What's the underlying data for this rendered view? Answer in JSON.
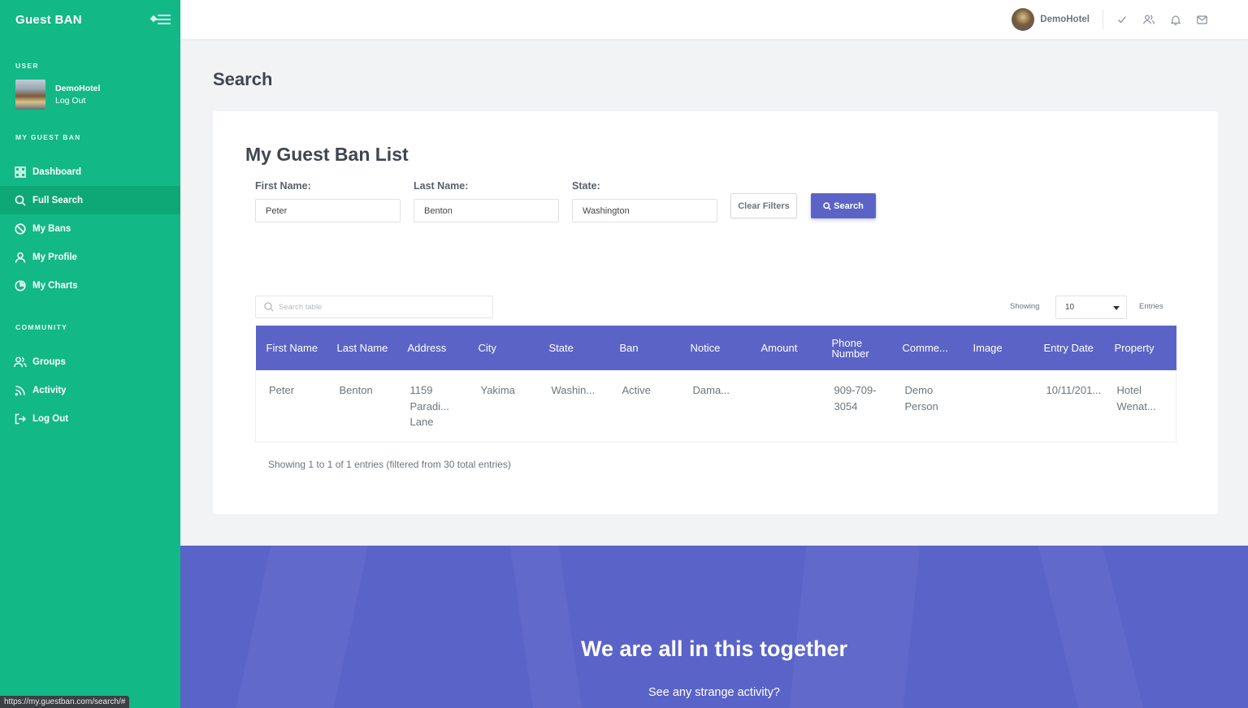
{
  "app": {
    "title": "Guest BAN"
  },
  "sidebar": {
    "user_section": "USER",
    "user_name": "DemoHotel",
    "logout_label": "Log Out",
    "main_section": "MY GUEST BAN",
    "main_items": [
      {
        "label": "Dashboard",
        "icon": "grid-icon",
        "active": false
      },
      {
        "label": "Full Search",
        "icon": "search-icon",
        "active": true
      },
      {
        "label": "My Bans",
        "icon": "ban-icon",
        "active": false
      },
      {
        "label": "My Profile",
        "icon": "user-icon",
        "active": false
      },
      {
        "label": "My Charts",
        "icon": "pie-chart-icon",
        "active": false
      }
    ],
    "community_section": "COMMUNITY",
    "community_items": [
      {
        "label": "Groups",
        "icon": "users-icon"
      },
      {
        "label": "Activity",
        "icon": "rss-icon"
      },
      {
        "label": "Log Out",
        "icon": "logout-icon"
      }
    ]
  },
  "header": {
    "user_name": "DemoHotel",
    "icons": [
      "check-icon",
      "users-icon",
      "bell-icon",
      "mail-icon"
    ]
  },
  "page": {
    "title": "Search"
  },
  "card": {
    "title": "My Guest Ban List",
    "filters": {
      "first_name_label": "First Name:",
      "first_name_value": "Peter",
      "last_name_label": "Last Name:",
      "last_name_value": "Benton",
      "state_label": "State:",
      "state_value": "Washington"
    },
    "clear_button": "Clear Filters",
    "search_button": "Search"
  },
  "table": {
    "search_placeholder": "Search table",
    "showing_label": "Showing",
    "page_size": "10",
    "entries_label": "Entries",
    "columns": [
      "First Name",
      "Last Name",
      "Address",
      "City",
      "State",
      "Ban",
      "Notice",
      "Amount",
      "Phone Number",
      "Comme...",
      "Image",
      "Entry Date",
      "Property"
    ],
    "rows": [
      [
        "Peter",
        "Benton",
        "1159 Paradi... Lane",
        "Yakima",
        "Washin...",
        "Active",
        "Dama...",
        "",
        "909-709-3054",
        "Demo Person",
        "",
        "10/11/201...",
        "Hotel Wenat..."
      ]
    ],
    "info": "Showing 1 to 1 of 1 entries (filtered from 30 total entries)"
  },
  "banner": {
    "title": "We are all in this together",
    "subtitle": "See any strange activity?"
  },
  "status_bar": {
    "url": "https://my.guestban.com/search/#"
  },
  "colors": {
    "sidebar": "#12b886",
    "accent": "#5b64c6",
    "banner": "#5a63c8"
  }
}
